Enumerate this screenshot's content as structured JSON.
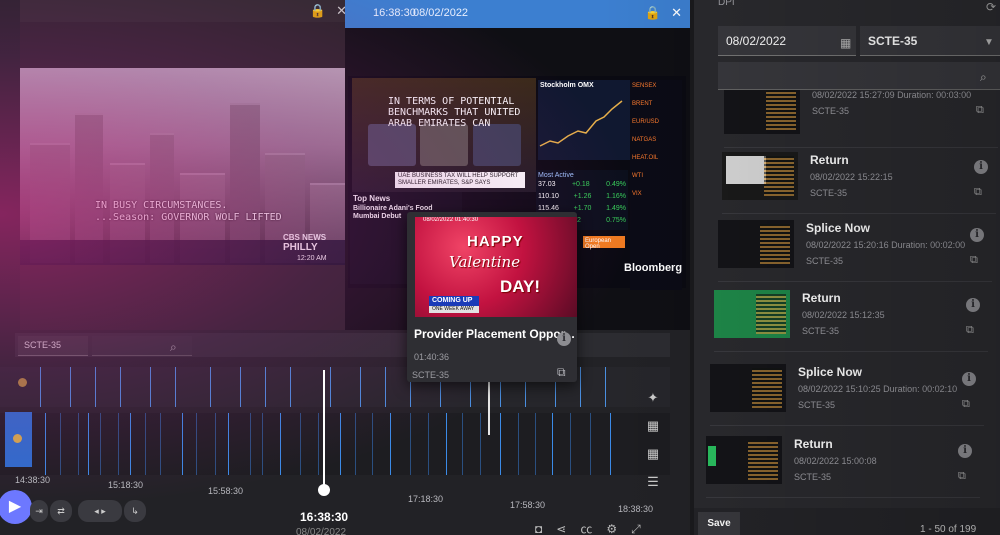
{
  "player1": {
    "caption_line1": "IN BUSY CIRCUMSTANCES.",
    "caption_line2": "...Season: GOVERNOR WOLF LIFTED",
    "network_tag": "CBS NEWS",
    "network_city": "PHILLY",
    "time": "12:20 AM"
  },
  "player2": {
    "header_time": "16:38:30",
    "header_date": "08/02/2022",
    "quote": "IN TERMS OF POTENTIAL BENCHMARKS THAT UNITED ARAB EMIRATES CAN",
    "lower_third": "UAE BUSINESS TAX WILL HELP SUPPORT SMALLER EMIRATES, S&P SAYS",
    "top_news_label": "Top News",
    "top_news_headline": "Billionaire Adani's Food Mumbai Debut",
    "chart_title": "Stockholm OMX",
    "most_active_label": "Most Active",
    "most_active": [
      {
        "price": "37.03",
        "change": "+0.18",
        "pct": "0.49%"
      },
      {
        "price": "110.10",
        "change": "+1.26",
        "pct": "1.16%"
      },
      {
        "price": "115.46",
        "change": "+1.70",
        "pct": "1.49%"
      },
      {
        "price": "",
        "change": "+0.22",
        "pct": "0.75%"
      }
    ],
    "ticker_lines": [
      "SENSEX",
      "BRENT",
      "EUR/USD",
      "NATGAS",
      "HEAT.OIL",
      "WTI",
      "VIX"
    ],
    "european_open": "European Open",
    "logo": "Bloomberg"
  },
  "hover_card": {
    "thumb_header": "08/02/2022 01:40:30",
    "happy": "HAPPY",
    "valentine": "Valentine",
    "day": "DAY!",
    "coming_up": "COMING UP",
    "coming_sub": "ONE WEEK AWAY",
    "title": "Provider Placement Oppor...",
    "duration": "01:40:36",
    "tag": "SCTE-35"
  },
  "timeline": {
    "filter_value": "SCTE-35",
    "labels": [
      "14:38:30",
      "15:18:30",
      "15:58:30",
      "17:18:30",
      "17:58:30",
      "18:38:30"
    ],
    "current_time": "16:38:30",
    "current_date": "08/02/2022"
  },
  "right_panel": {
    "header": "DPI",
    "date_value": "08/02/2022",
    "type_value": "SCTE-35",
    "items": [
      {
        "title": "",
        "sub": "08/02/2022 15:27:09 Duration: 00:03:00",
        "tag": "SCTE-35"
      },
      {
        "title": "Return",
        "sub": "08/02/2022 15:22:15",
        "tag": "SCTE-35"
      },
      {
        "title": "Splice Now",
        "sub": "08/02/2022 15:20:16 Duration: 00:02:00",
        "tag": "SCTE-35"
      },
      {
        "title": "Return",
        "sub": "08/02/2022 15:12:35",
        "tag": "SCTE-35"
      },
      {
        "title": "Splice Now",
        "sub": "08/02/2022 15:10:25 Duration: 00:02:10",
        "tag": "SCTE-35"
      },
      {
        "title": "Return",
        "sub": "08/02/2022 15:00:08",
        "tag": "SCTE-35"
      }
    ],
    "save_label": "Save",
    "pager": "1 - 50 of 199"
  },
  "colors": {
    "accent_blue": "#3c7fd0",
    "play_purple": "#6d78ff",
    "tick_blue": "#4a8fe0"
  }
}
